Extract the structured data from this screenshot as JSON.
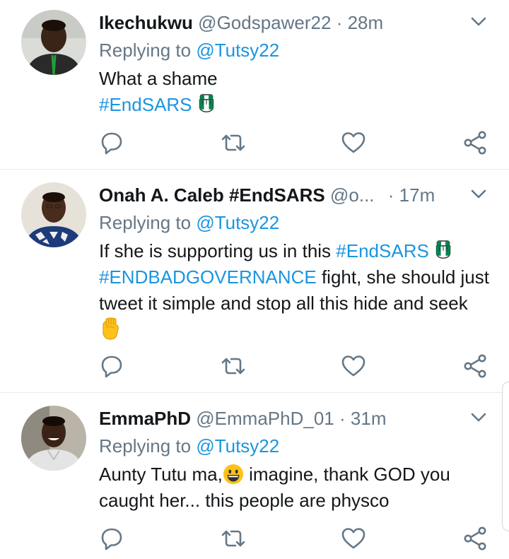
{
  "tweets": [
    {
      "name": "Ikechukwu",
      "handle": "@Godspawer22",
      "separator": "·",
      "time": "28m",
      "replying_label": "Replying to",
      "replying_handle": "@Tutsy22",
      "body_line1": "What a shame",
      "hashtag1": "#EndSARS",
      "fist_emoji": "nigeria-fist-emoji"
    },
    {
      "name": "Onah A. Caleb #EndSARS",
      "handle": "@o...",
      "separator": "·",
      "time": "17m",
      "replying_label": "Replying to",
      "replying_handle": "@Tutsy22",
      "body_part1": "If she is supporting us in this ",
      "hashtag1": "#EndSARS",
      "hashtag2": "#ENDBADGOVERNANCE",
      "body_part2": " fight, she should just tweet it simple and stop all this hide and seek ",
      "fist_emoji": "nigeria-fist-emoji",
      "raised_fist_emoji": "raised-fist-emoji"
    },
    {
      "name": "EmmaPhD",
      "handle": "@EmmaPhD_01",
      "separator": "·",
      "time": "31m",
      "replying_label": "Replying to",
      "replying_handle": "@Tutsy22",
      "body_part1": "Aunty Tutu ma,",
      "body_part2": " imagine, thank GOD you caught her... this people are physco",
      "smile_emoji": "grinning-face-emoji"
    }
  ],
  "icons": {
    "reply": "reply-icon",
    "retweet": "retweet-icon",
    "like": "heart-icon",
    "share": "share-icon",
    "menu": "chevron-down-icon"
  },
  "colors": {
    "link": "#1b95e0",
    "secondary_text": "#657786",
    "primary_text": "#14171a",
    "divider": "#e6ecf0",
    "nigeria_green": "#008751"
  }
}
